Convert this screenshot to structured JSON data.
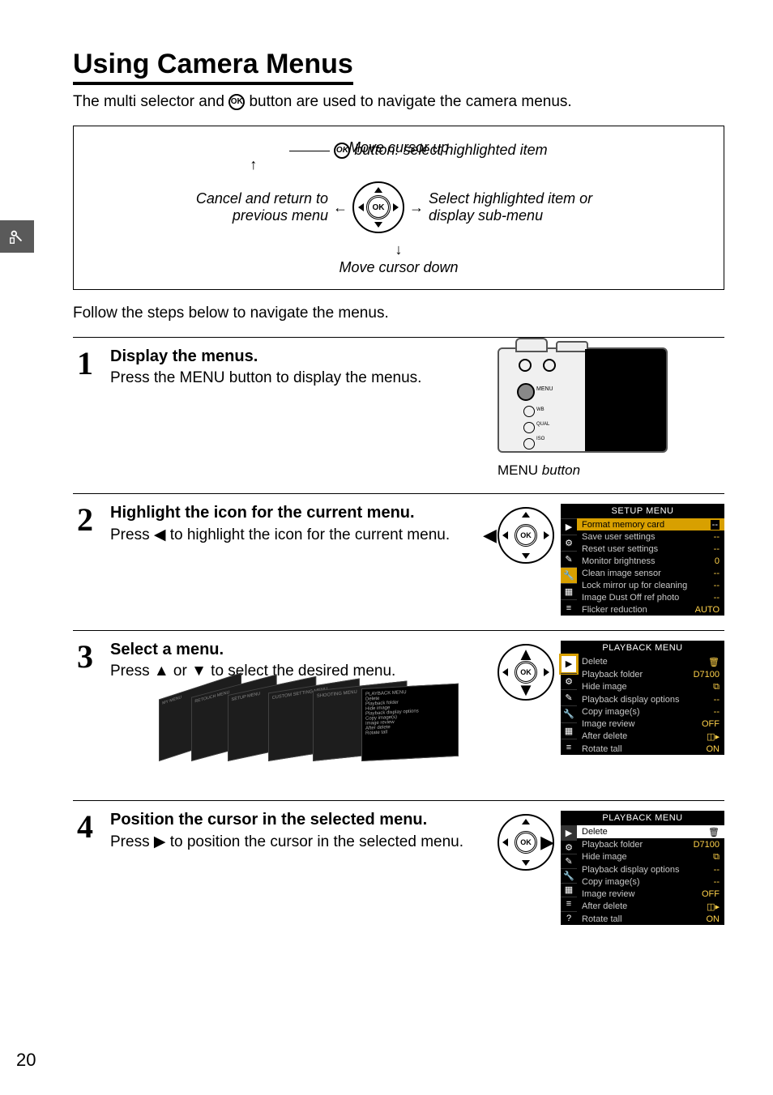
{
  "page": {
    "number": "20",
    "title": "Using Camera Menus",
    "intro_before": "The multi selector and ",
    "intro_after": " button are used to navigate the camera menus.",
    "follow": "Follow the steps below to navigate the menus."
  },
  "diagram": {
    "move_up": "Move cursor up",
    "move_down": "Move cursor down",
    "ok_label": " button: select highlighted item",
    "left_line1": "Cancel and return to",
    "left_line2": "previous menu",
    "right_line1": "Select highlighted item or",
    "right_line2": "display sub-menu",
    "ok_core": "OK"
  },
  "steps": [
    {
      "n": "1",
      "title": "Display the menus.",
      "body_before": "Press the ",
      "body_menu": "MENU",
      "body_after": " button to display the menus.",
      "caption_menu": "MENU",
      "caption_after": " button"
    },
    {
      "n": "2",
      "title": "Highlight the icon for the current menu.",
      "body": "Press ◀ to highlight the icon for the current menu.",
      "screen": {
        "title": "SETUP MENU",
        "rows": [
          {
            "label": "Format memory card",
            "val": "--",
            "hl": true
          },
          {
            "label": "Save user settings",
            "val": "--"
          },
          {
            "label": "Reset user settings",
            "val": "--"
          },
          {
            "label": "Monitor brightness",
            "val": "0"
          },
          {
            "label": "Clean image sensor",
            "val": "--"
          },
          {
            "label": "Lock mirror up for cleaning",
            "val": "--"
          },
          {
            "label": "Image Dust Off ref photo",
            "val": "--"
          },
          {
            "label": "Flicker reduction",
            "val": "AUTO"
          }
        ]
      }
    },
    {
      "n": "3",
      "title": "Select a menu.",
      "body": "Press ▲ or ▼ to select the desired menu.",
      "screen": {
        "title": "PLAYBACK MENU",
        "rows": [
          {
            "label": "Delete",
            "val": "🗑"
          },
          {
            "label": "Playback folder",
            "val": "D7100"
          },
          {
            "label": "Hide image",
            "val": "⧉"
          },
          {
            "label": "Playback display options",
            "val": "--"
          },
          {
            "label": "Copy image(s)",
            "val": "--"
          },
          {
            "label": "Image review",
            "val": "OFF"
          },
          {
            "label": "After delete",
            "val": "◫▸"
          },
          {
            "label": "Rotate tall",
            "val": "ON"
          }
        ]
      }
    },
    {
      "n": "4",
      "title": "Position the cursor in the selected menu.",
      "body": "Press ▶ to position the cursor in the selected menu.",
      "screen": {
        "title": "PLAYBACK MENU",
        "rows": [
          {
            "label": "Delete",
            "val": "🗑",
            "sel": true
          },
          {
            "label": "Playback folder",
            "val": "D7100"
          },
          {
            "label": "Hide image",
            "val": "⧉"
          },
          {
            "label": "Playback display options",
            "val": "--"
          },
          {
            "label": "Copy image(s)",
            "val": "--"
          },
          {
            "label": "Image review",
            "val": "OFF"
          },
          {
            "label": "After delete",
            "val": "◫▸"
          },
          {
            "label": "Rotate tall",
            "val": "ON"
          }
        ]
      }
    }
  ]
}
